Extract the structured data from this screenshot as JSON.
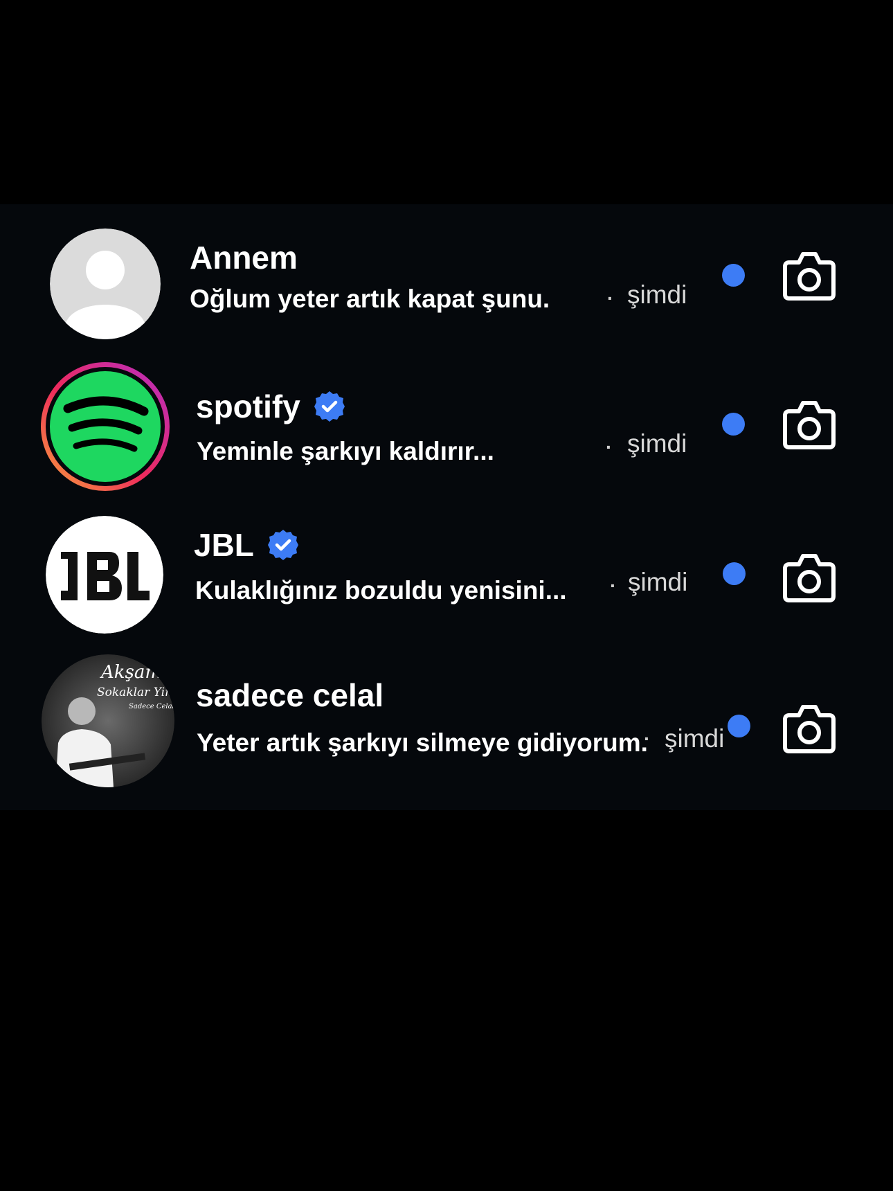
{
  "colors": {
    "unread_dot": "#3d7cf5",
    "verified_badge": "#3d7cf5",
    "spotify_green": "#1ed760",
    "panel_bg": "#05080c"
  },
  "conversations": [
    {
      "name": "Annem",
      "verified": false,
      "message": "Oğlum yeter artık kapat şunu.",
      "separator": "·",
      "time": "şimdi",
      "avatar": "default-person-icon",
      "unread": true
    },
    {
      "name": "spotify",
      "verified": true,
      "message": "Yeminle şarkıyı kaldırır...",
      "separator": "·",
      "time": "şimdi",
      "avatar": "spotify-logo",
      "story_ring": true,
      "unread": true
    },
    {
      "name": "JBL",
      "verified": true,
      "message": "Kulaklığınız bozuldu yenisini...",
      "separator": "·",
      "time": "şimdi",
      "avatar": "jbl-logo",
      "unread": true
    },
    {
      "name": "sadece celal",
      "verified": false,
      "message": "Yeter artık şarkıyı silmeye gidiyorum.",
      "separator": "·",
      "time": "şimdi",
      "avatar": "album-cover-photo",
      "avatar_text": [
        "Akşam",
        "Sokaklar Yine",
        "Sadece Celal"
      ],
      "unread": true
    }
  ]
}
